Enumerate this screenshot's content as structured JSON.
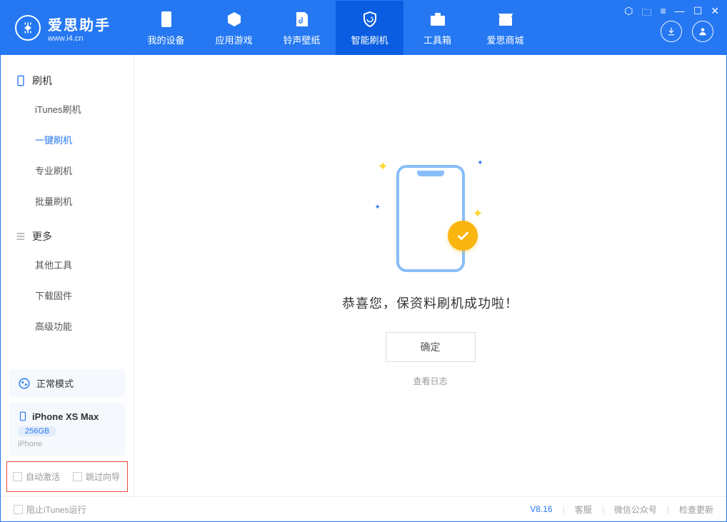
{
  "header": {
    "logo_main": "爱思助手",
    "logo_sub": "www.i4.cn",
    "tabs": [
      {
        "label": "我的设备"
      },
      {
        "label": "应用游戏"
      },
      {
        "label": "铃声壁纸"
      },
      {
        "label": "智能刷机"
      },
      {
        "label": "工具箱"
      },
      {
        "label": "爱思商城"
      }
    ]
  },
  "sidebar": {
    "section1_title": "刷机",
    "items1": [
      {
        "label": "iTunes刷机"
      },
      {
        "label": "一键刷机"
      },
      {
        "label": "专业刷机"
      },
      {
        "label": "批量刷机"
      }
    ],
    "section2_title": "更多",
    "items2": [
      {
        "label": "其他工具"
      },
      {
        "label": "下载固件"
      },
      {
        "label": "高级功能"
      }
    ],
    "mode_text": "正常模式",
    "device_name": "iPhone XS Max",
    "device_capacity": "256GB",
    "device_type": "iPhone",
    "checkbox_auto_activate": "自动激活",
    "checkbox_skip_guide": "跳过向导"
  },
  "main": {
    "success_text": "恭喜您，保资料刷机成功啦！",
    "ok_button": "确定",
    "view_log": "查看日志"
  },
  "footer": {
    "block_itunes": "阻止iTunes运行",
    "version": "V8.16",
    "customer_service": "客服",
    "wechat": "微信公众号",
    "check_update": "检查更新"
  }
}
